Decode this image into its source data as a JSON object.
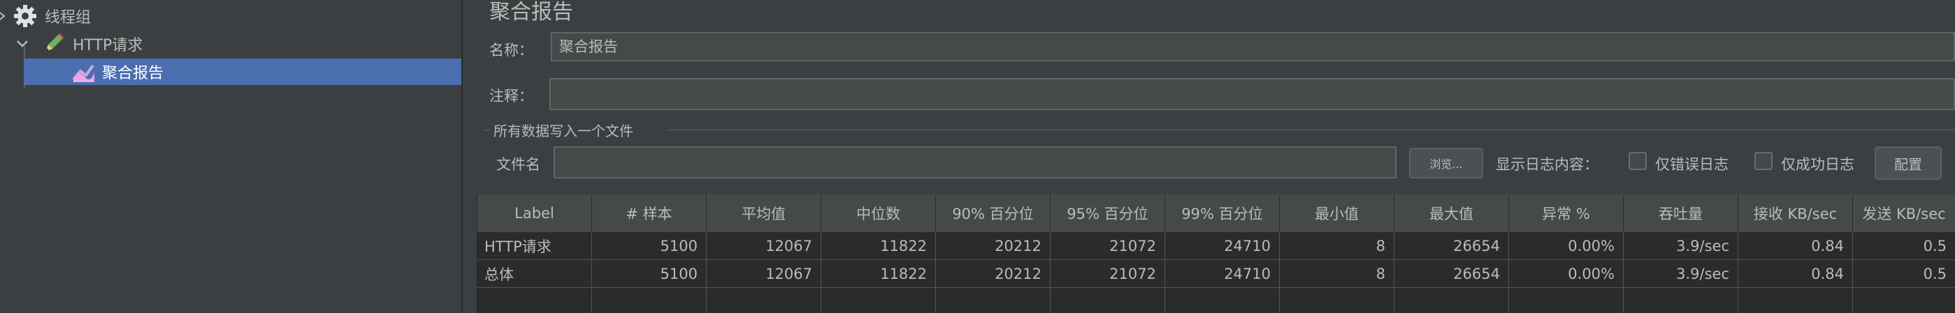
{
  "tree": {
    "items": [
      {
        "label": "线程组",
        "icon": "gear-icon"
      },
      {
        "label": "HTTP请求",
        "icon": "pencil-icon",
        "expander": "chevron-down-icon"
      },
      {
        "label": "聚合报告",
        "icon": "chart-icon"
      }
    ]
  },
  "panel": {
    "title": "聚合报告",
    "name_label": "名称：",
    "name_value": "聚合报告",
    "comment_label": "注释：",
    "comment_value": "",
    "file_group_title": "所有数据写入一个文件",
    "filename_label": "文件名",
    "filename_value": "",
    "browse_button": "浏览...",
    "log_content_label": "显示日志内容：",
    "errors_only_label": "仅错误日志",
    "success_only_label": "仅成功日志",
    "config_button": "配置"
  },
  "table": {
    "headers": [
      "Label",
      "# 样本",
      "平均值",
      "中位数",
      "90% 百分位",
      "95% 百分位",
      "99% 百分位",
      "最小值",
      "最大值",
      "异常 %",
      "吞吐量",
      "接收 KB/sec",
      "发送 KB/sec"
    ],
    "rows": [
      [
        "HTTP请求",
        "5100",
        "12067",
        "11822",
        "20212",
        "21072",
        "24710",
        "8",
        "26654",
        "0.00%",
        "3.9/sec",
        "0.84",
        "0.5"
      ],
      [
        "总体",
        "5100",
        "12067",
        "11822",
        "20212",
        "21072",
        "24710",
        "8",
        "26654",
        "0.00%",
        "3.9/sec",
        "0.84",
        "0.5"
      ]
    ]
  },
  "colors": {
    "background": "#3c3f41",
    "selection": "#4b6eaf",
    "table_header": "#45494a",
    "table_body": "#2b2b2b"
  }
}
